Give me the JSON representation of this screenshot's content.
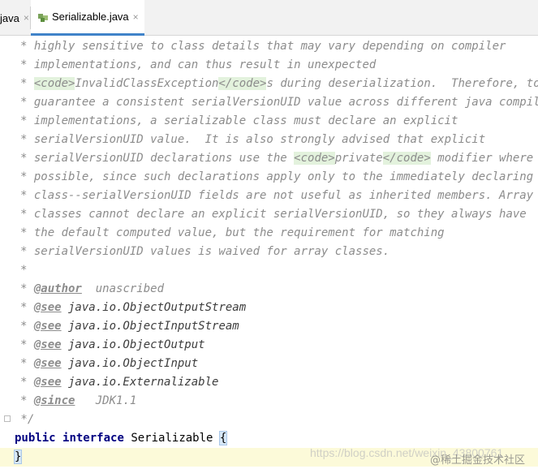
{
  "tabs": {
    "prev_label": "java",
    "prev_close": "×",
    "active_label": "Serializable.java",
    "active_close": "×"
  },
  "doc_lines": [
    {
      "segments": [
        {
          "t": "highly sensitive to class details that may vary depending on compiler"
        }
      ]
    },
    {
      "segments": [
        {
          "t": "implementations, and can thus result in unexpected"
        }
      ]
    },
    {
      "segments": [
        {
          "code": "<code>"
        },
        {
          "t": "InvalidClassException"
        },
        {
          "code": "</code>"
        },
        {
          "t": "s during deserialization.  Therefore, to"
        }
      ]
    },
    {
      "segments": [
        {
          "t": "guarantee a consistent serialVersionUID value across different java compiler"
        }
      ]
    },
    {
      "segments": [
        {
          "t": "implementations, a serializable class must declare an explicit"
        }
      ]
    },
    {
      "segments": [
        {
          "t": "serialVersionUID value.  It is also strongly advised that explicit"
        }
      ]
    },
    {
      "segments": [
        {
          "t": "serialVersionUID declarations use the "
        },
        {
          "code": "<code>"
        },
        {
          "t": "private"
        },
        {
          "code": "</code>"
        },
        {
          "t": " modifier where"
        }
      ]
    },
    {
      "segments": [
        {
          "t": "possible, since such declarations apply only to the immediately declaring"
        }
      ]
    },
    {
      "segments": [
        {
          "t": "class--serialVersionUID fields are not useful as inherited members. Array"
        }
      ]
    },
    {
      "segments": [
        {
          "t": "classes cannot declare an explicit serialVersionUID, so they always have"
        }
      ]
    },
    {
      "segments": [
        {
          "t": "the default computed value, but the requirement for matching"
        }
      ]
    },
    {
      "segments": [
        {
          "t": "serialVersionUID values is waived for array classes."
        }
      ]
    },
    {
      "segments": []
    },
    {
      "segments": [
        {
          "tag": "@author"
        },
        {
          "t": "  unascribed"
        }
      ]
    },
    {
      "segments": [
        {
          "tag": "@see"
        },
        {
          "ref": " java.io.ObjectOutputStream"
        }
      ]
    },
    {
      "segments": [
        {
          "tag": "@see"
        },
        {
          "ref": " java.io.ObjectInputStream"
        }
      ]
    },
    {
      "segments": [
        {
          "tag": "@see"
        },
        {
          "ref": " java.io.ObjectOutput"
        }
      ]
    },
    {
      "segments": [
        {
          "tag": "@see"
        },
        {
          "ref": " java.io.ObjectInput"
        }
      ]
    },
    {
      "segments": [
        {
          "tag": "@see"
        },
        {
          "ref": " java.io.Externalizable"
        }
      ]
    },
    {
      "segments": [
        {
          "tag": "@since"
        },
        {
          "t": "   JDK1.1"
        }
      ]
    }
  ],
  "doc_star": "*",
  "doc_close": " */",
  "decl": {
    "kw1": "public",
    "kw2": "interface",
    "name": "Serializable",
    "open_brace": "{",
    "close_brace": "}"
  },
  "watermark": {
    "url": "https://blog.csdn.net/weixin_43800761",
    "community": "@稀土掘金技术社区"
  }
}
